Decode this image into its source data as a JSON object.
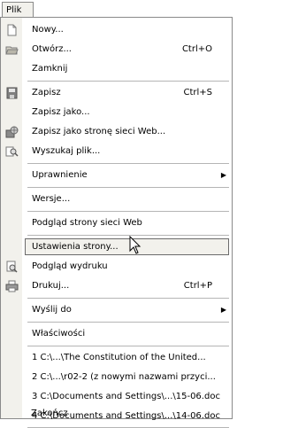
{
  "menubar": {
    "file_label": "Plik"
  },
  "menu": {
    "items": [
      {
        "label": "Nowy...",
        "shortcut": "",
        "icon": "new-document-icon"
      },
      {
        "label": "Otwórz...",
        "shortcut": "Ctrl+O",
        "icon": "open-folder-icon"
      },
      {
        "label": "Zamknij",
        "shortcut": "",
        "icon": ""
      },
      {
        "label": "Zapisz",
        "shortcut": "Ctrl+S",
        "icon": "save-disk-icon"
      },
      {
        "label": "Zapisz jako...",
        "shortcut": "",
        "icon": ""
      },
      {
        "label": "Zapisz jako stronę sieci Web...",
        "shortcut": "",
        "icon": "save-as-web-icon"
      },
      {
        "label": "Wyszukaj plik...",
        "shortcut": "",
        "icon": "search-file-icon"
      },
      {
        "label": "Uprawnienie",
        "shortcut": "",
        "submenu": true
      },
      {
        "label": "Wersje...",
        "shortcut": ""
      },
      {
        "label": "Podgląd strony sieci Web",
        "shortcut": ""
      },
      {
        "label": "Ustawienia strony...",
        "shortcut": "",
        "highlighted": true
      },
      {
        "label": "Podgląd wydruku",
        "shortcut": "",
        "icon": "print-preview-icon"
      },
      {
        "label": "Drukuj...",
        "shortcut": "Ctrl+P",
        "icon": "printer-icon"
      },
      {
        "label": "Wyślij do",
        "shortcut": "",
        "submenu": true
      },
      {
        "label": "Właściwości",
        "shortcut": ""
      },
      {
        "label": "1 C:\\...\\The Constitution of the United...",
        "shortcut": ""
      },
      {
        "label": "2 C:\\...\\r02-2 (z nowymi nazwami przyci...",
        "shortcut": ""
      },
      {
        "label": "3 C:\\Documents and Settings\\...\\15-06.doc",
        "shortcut": ""
      },
      {
        "label": "4 C:\\Documents and Settings\\...\\14-06.doc",
        "shortcut": ""
      },
      {
        "label": "Zakończ",
        "shortcut": ""
      }
    ]
  }
}
